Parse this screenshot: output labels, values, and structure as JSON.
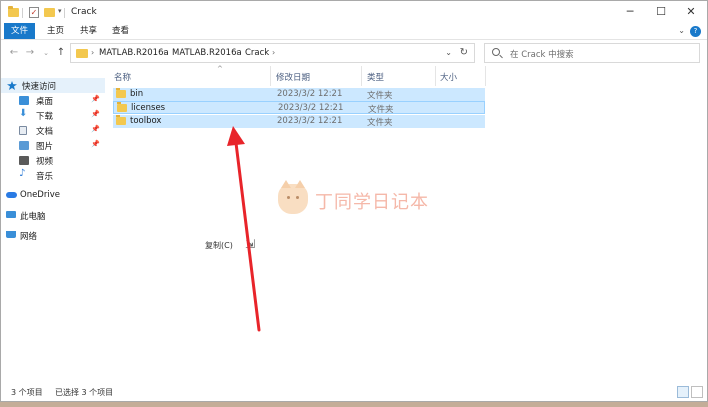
{
  "window": {
    "title": "Crack",
    "controls": {
      "minimize": "─",
      "maximize": "☐",
      "close": "✕"
    }
  },
  "ribbon": {
    "tabs": [
      "文件",
      "主页",
      "共享",
      "查看"
    ],
    "help": "?"
  },
  "address_bar": {
    "breadcrumbs": [
      "MATLAB.R2016a",
      "MATLAB.R2016a",
      "Crack"
    ],
    "search_placeholder": "在 Crack 中搜索"
  },
  "sidebar": {
    "items": [
      {
        "label": "快速访问",
        "icon": "star-icon",
        "color": "#1979ca",
        "pinned": false
      },
      {
        "label": "桌面",
        "icon": "desktop-icon",
        "color": "#3a8fd8",
        "pinned": true
      },
      {
        "label": "下载",
        "icon": "download-icon",
        "color": "#3a8fd8",
        "pinned": true
      },
      {
        "label": "文档",
        "icon": "document-icon",
        "color": "#7a8aa0",
        "pinned": true
      },
      {
        "label": "图片",
        "icon": "pictures-icon",
        "color": "#5b9bd5",
        "pinned": true
      },
      {
        "label": "视频",
        "icon": "video-icon",
        "color": "#5a5a5a",
        "pinned": false
      },
      {
        "label": "音乐",
        "icon": "music-icon",
        "color": "#2e7bd6",
        "pinned": false
      },
      {
        "label": "OneDrive",
        "icon": "onedrive-icon",
        "color": "#2a7be4",
        "pinned": false
      },
      {
        "label": "此电脑",
        "icon": "computer-icon",
        "color": "#3a8fd8",
        "pinned": false
      },
      {
        "label": "网络",
        "icon": "network-icon",
        "color": "#3a8fd8",
        "pinned": false
      }
    ]
  },
  "columns": [
    "名称",
    "修改日期",
    "类型",
    "大小"
  ],
  "files": [
    {
      "name": "bin",
      "date": "2023/3/2 12:21",
      "type": "文件夹"
    },
    {
      "name": "licenses",
      "date": "2023/3/2 12:21",
      "type": "文件夹"
    },
    {
      "name": "toolbox",
      "date": "2023/3/2 12:21",
      "type": "文件夹"
    }
  ],
  "watermark": "丁同学日记本",
  "context_hint": "复制(C)",
  "status": {
    "count": "3 个项目",
    "selected": "已选择 3 个项目"
  },
  "colors": {
    "accent": "#1979ca",
    "selection": "#cce8ff",
    "folder": "#f3c84f",
    "arrow": "#e8242a"
  }
}
